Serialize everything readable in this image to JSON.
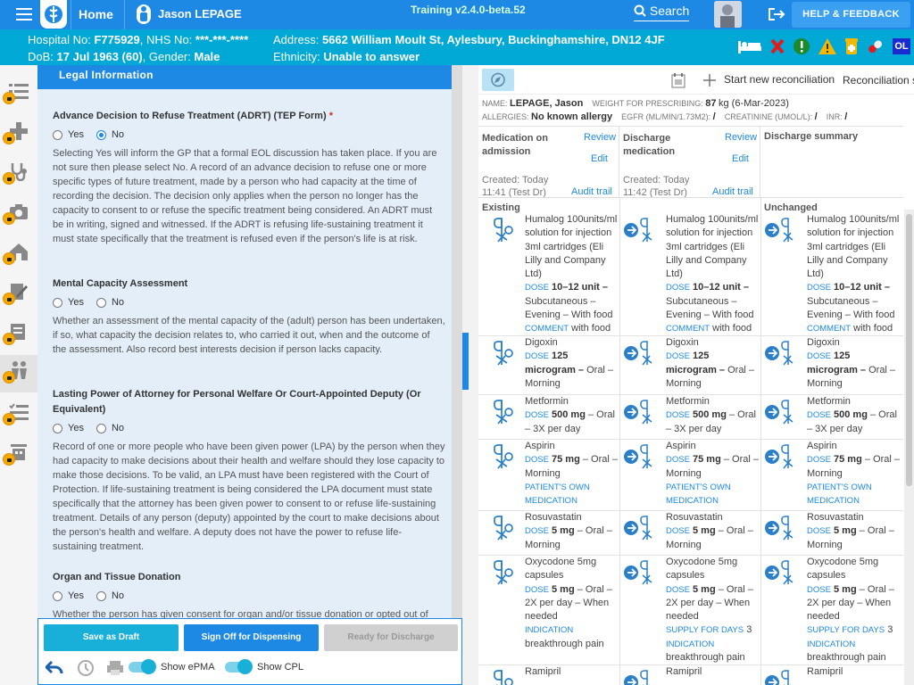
{
  "topbar": {
    "home": "Home",
    "patient_name": "Jason LEPAGE",
    "version": "Training v2.4.0-beta.52",
    "search": "Search",
    "help": "HELP & FEEDBACK"
  },
  "banner": {
    "hospital_no": "F775929",
    "nhs_no": "***-***-****",
    "dob": "17 Jul 1963 (60)",
    "gender": "Male",
    "address": "5662 William Moult St, Aylesbury, Buckinghamshire, DN12 4JF",
    "ethnicity": "Unable to answer",
    "hosp_label": "Hospital No:",
    "nhs_label": "NHS No:",
    "dob_label": "DoB:",
    "gender_label": "Gender:",
    "addr_label": "Address:",
    "eth_label": "Ethnicity:",
    "badge": "OL"
  },
  "form": {
    "section_title": "Legal Information",
    "q1": {
      "title": "Advance Decision to Refuse Treatment (ADRT) (TEP Form)",
      "required": "*",
      "yes": "Yes",
      "no": "No",
      "selected": "No",
      "text": "Selecting Yes will inform the GP that a formal EOL discussion has taken place. If you are not sure then please select No. A record of an advance decision to refuse one or more specific types of future treatment, made by a person who had capacity at the time of recording the decision. The decision only applies when the person no longer has the capacity to consent to or refuse the specific treatment being considered. An ADRT must be in writing, signed and witnessed. If the ADRT is refusing life-sustaining treatment it must state specifically that the treatment is refused even if the person's life is at risk."
    },
    "q2": {
      "title": "Mental Capacity Assessment",
      "yes": "Yes",
      "no": "No",
      "text": "Whether an assessment of the mental capacity of the (adult) person has been undertaken, if so, what capacity the decision relates to, who carried it out, when and the outcome of the assessment. Also record best interests decision if person lacks capacity."
    },
    "q3": {
      "title": "Lasting Power of Attorney for Personal Welfare Or Court-Appointed Deputy (Or Equivalent)",
      "yes": "Yes",
      "no": "No",
      "text": "Record of one or more people who have been given power (LPA) by the person when they had capacity to make decisions about their health and welfare should they lose capacity to make those decisions. To be valid, an LPA must have been registered with the Court of Protection. If life-sustaining treatment is being considered the LPA document must state specifically that the attorney has been given power to consent to or refuse life-sustaining treatment. Details of any person (deputy) appointed by the court to make decisions about the person's health and welfare. A deputy does not have the power to refuse life-sustaining treatment."
    },
    "q4": {
      "title": "Organ and Tissue Donation",
      "yes": "Yes",
      "no": "No",
      "text": "Whether the person has given consent for organ and/or tissue donation or opted out of"
    }
  },
  "footer": {
    "save": "Save as Draft",
    "signoff": "Sign Off for Dispensing",
    "ready": "Ready for Discharge",
    "show_epma": "Show ePMA",
    "show_cpl": "Show CPL"
  },
  "recon": {
    "start": "Start new reconciliation",
    "status": "Reconciliation st",
    "name_label": "NAME:",
    "name": "LEPAGE, Jason",
    "weight_label": "WEIGHT FOR PRESCRIBING:",
    "weight": "87",
    "weight_rest": "kg (6-Mar-2023)",
    "allergy_label": "ALLERGIES:",
    "allergy": "No known allergy",
    "egfr_label": "EGFR (ML/MIN/1.73M2):",
    "egfr": "/",
    "creat_label": "CREATININE (UMOL/L):",
    "creat": "/",
    "inr_label": "INR:",
    "inr": "/",
    "col1": {
      "title1": "Medication on",
      "title2": "admission",
      "review": "Review",
      "edit": "Edit",
      "created": "Created: Today",
      "time": "11:41 (Test Dr)",
      "audit": "Audit trail"
    },
    "col2": {
      "title1": "Discharge",
      "title2": "medication",
      "review": "Review",
      "edit": "Edit",
      "created": "Created: Today",
      "time": "11:42 (Test Dr)",
      "audit": "Audit trail"
    },
    "col3": {
      "title1": "Discharge summary"
    },
    "sect1": "Existing",
    "sect3": "Unchanged"
  },
  "meds": [
    {
      "name": "Humalog 100units/ml solution for injection 3ml cartridges (Eli Lilly and Company Ltd)",
      "dose_label": "DOSE",
      "dose": "10–12 unit –",
      "route": "Subcutaneous – Evening – With food",
      "c_label": "COMMENT",
      "c_val": "with food"
    },
    {
      "name": "Digoxin",
      "dose_label": "DOSE",
      "dose": "125 microgram –",
      "route": "Oral – Morning"
    },
    {
      "name": "Metformin",
      "dose_label": "DOSE",
      "dose": "500 mg",
      "route": "– Oral – 3X per day"
    },
    {
      "name": "Aspirin",
      "dose_label": "DOSE",
      "dose": "75 mg",
      "route": "– Oral – Morning",
      "x_label": "PATIENT'S OWN MEDICATION"
    },
    {
      "name": "Rosuvastatin",
      "dose_label": "DOSE",
      "dose": "5 mg",
      "route": "– Oral – Morning"
    },
    {
      "name": "Oxycodone 5mg capsules",
      "dose_label": "DOSE",
      "dose": "5 mg",
      "route": "– Oral – 2X per day – When needed",
      "ind_label": "INDICATION",
      "ind": "breakthrough pain",
      "sup_label": "SUPPLY FOR DAYS",
      "sup": "3"
    },
    {
      "name": "Ramipril"
    }
  ]
}
